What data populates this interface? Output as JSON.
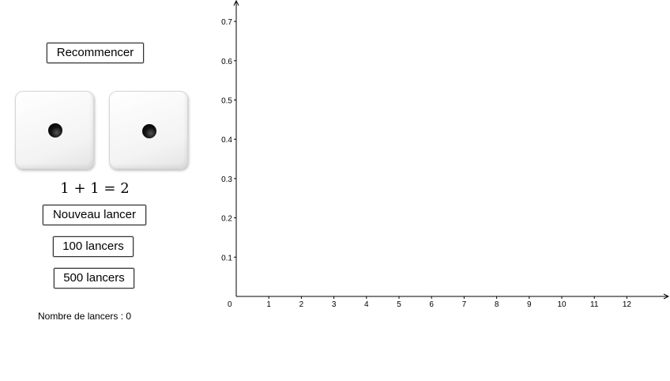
{
  "buttons": {
    "reset": "Recommencer",
    "new_roll": "Nouveau lancer",
    "roll_100": "100 lancers",
    "roll_500": "500 lancers"
  },
  "dice": [
    {
      "value": 1
    },
    {
      "value": 1
    }
  ],
  "sum_expression": "1 + 1 = 2",
  "roll_count": {
    "label": "Nombre de lancers : ",
    "value": "0"
  },
  "chart_data": {
    "type": "bar",
    "origin_label": "0",
    "x_ticks": [
      "1",
      "2",
      "3",
      "4",
      "5",
      "6",
      "7",
      "8",
      "9",
      "10",
      "11",
      "12"
    ],
    "y_ticks": [
      "0.1",
      "0.2",
      "0.3",
      "0.4",
      "0.5",
      "0.6",
      "0.7"
    ],
    "xlim": [
      0,
      13.2
    ],
    "ylim": [
      0,
      0.7
    ],
    "categories": [],
    "values": []
  }
}
